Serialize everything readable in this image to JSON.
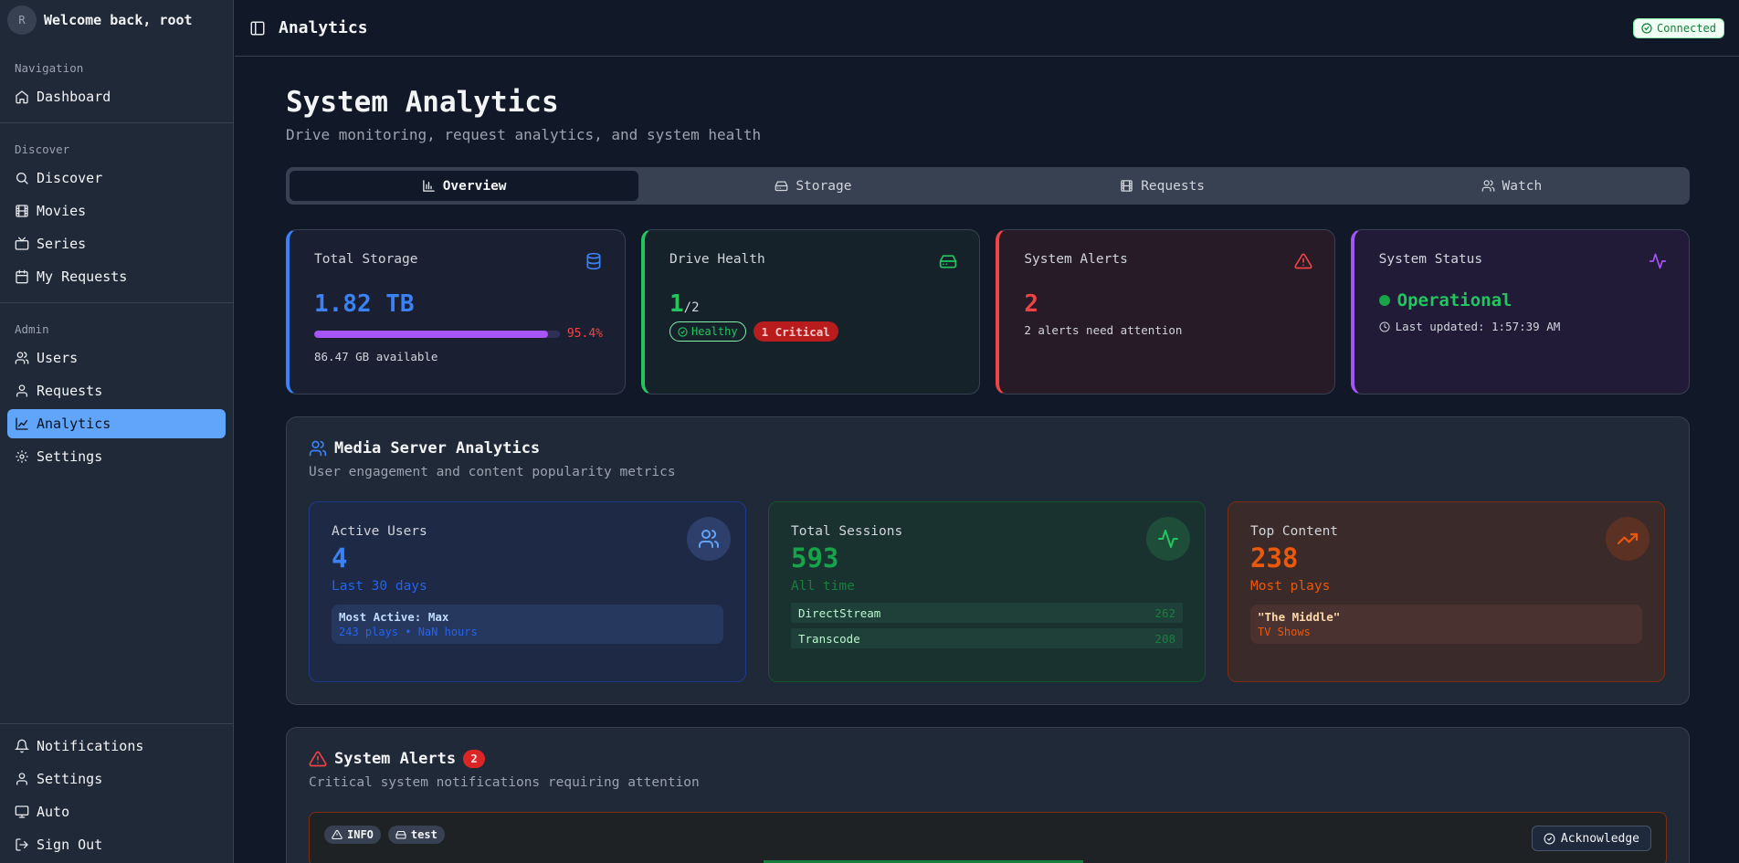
{
  "sidebar": {
    "avatar_initial": "R",
    "welcome": "Welcome back, root",
    "groups": [
      {
        "label": "Navigation",
        "items": [
          {
            "label": "Dashboard",
            "icon": "home-icon"
          }
        ]
      },
      {
        "label": "Discover",
        "items": [
          {
            "label": "Discover",
            "icon": "search-icon"
          },
          {
            "label": "Movies",
            "icon": "film-icon"
          },
          {
            "label": "Series",
            "icon": "tv-icon"
          },
          {
            "label": "My Requests",
            "icon": "calendar-icon"
          }
        ]
      },
      {
        "label": "Admin",
        "items": [
          {
            "label": "Users",
            "icon": "users-icon"
          },
          {
            "label": "Requests",
            "icon": "user-icon"
          },
          {
            "label": "Analytics",
            "icon": "chart-icon",
            "active": true
          },
          {
            "label": "Settings",
            "icon": "gear-icon"
          }
        ]
      }
    ],
    "footer": [
      {
        "label": "Notifications",
        "icon": "bell-icon"
      },
      {
        "label": "Settings",
        "icon": "user-icon"
      },
      {
        "label": "Auto",
        "icon": "monitor-icon"
      },
      {
        "label": "Sign Out",
        "icon": "logout-icon"
      }
    ]
  },
  "topbar": {
    "title": "Analytics",
    "status": "Connected"
  },
  "page": {
    "title": "System Analytics",
    "subtitle": "Drive monitoring, request analytics, and system health"
  },
  "tabs": [
    {
      "label": "Overview",
      "active": true
    },
    {
      "label": "Storage"
    },
    {
      "label": "Requests"
    },
    {
      "label": "Watch"
    }
  ],
  "stats": {
    "storage": {
      "label": "Total Storage",
      "value": "1.82 TB",
      "percent": "95.4%",
      "fill_fraction": 0.954,
      "available": "86.47 GB available"
    },
    "health": {
      "label": "Drive Health",
      "value": "1",
      "total": "/2",
      "healthy": "Healthy",
      "critical": "1 Critical"
    },
    "alerts": {
      "label": "System Alerts",
      "value": "2",
      "note": "2 alerts need attention"
    },
    "status": {
      "label": "System Status",
      "value": "Operational",
      "updated": "Last updated: 1:57:39 AM"
    }
  },
  "media": {
    "title": "Media Server Analytics",
    "subtitle": "User engagement and content popularity metrics",
    "active_users": {
      "label": "Active Users",
      "value": "4",
      "sub": "Last 30 days",
      "box_title": "Most Active: Max",
      "box_sub": "243 plays • NaN hours"
    },
    "sessions": {
      "label": "Total Sessions",
      "value": "593",
      "sub": "All time",
      "rows": [
        {
          "name": "DirectStream",
          "count": "262"
        },
        {
          "name": "Transcode",
          "count": "208"
        }
      ]
    },
    "top_content": {
      "label": "Top Content",
      "value": "238",
      "sub": "Most plays",
      "box_title": "\"The Middle\"",
      "box_sub": "TV Shows"
    }
  },
  "system_alerts": {
    "title": "System Alerts",
    "count": "2",
    "subtitle": "Critical system notifications requiring attention",
    "first": {
      "level": "INFO",
      "tag": "test",
      "action": "Acknowledge"
    }
  },
  "colors": {
    "accent": "#60a5fa",
    "blue": "#3b82f6",
    "green": "#22c55e",
    "red": "#ef4444",
    "purple": "#a855f7",
    "orange": "#ea580c"
  }
}
